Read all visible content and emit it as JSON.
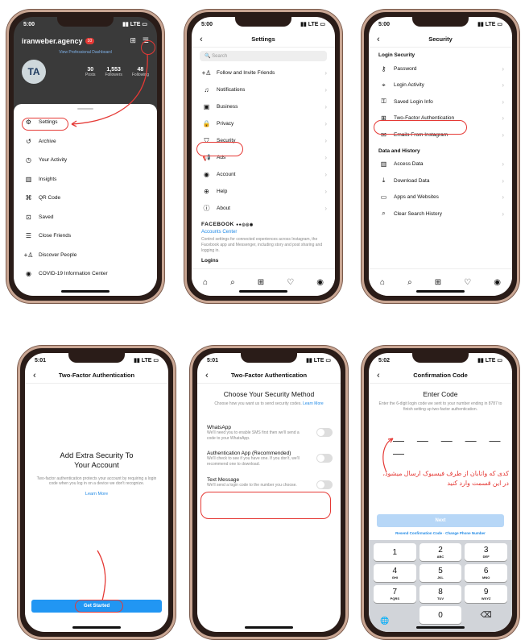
{
  "p1": {
    "time": "5:00",
    "username": "iranweber.agency",
    "badge": "10",
    "profile_link": "View Professional Dashboard",
    "stats": [
      {
        "n": "30",
        "l": "Posts"
      },
      {
        "n": "1,553",
        "l": "Followers"
      },
      {
        "n": "48",
        "l": "Following"
      }
    ],
    "menu": [
      {
        "label": "Settings",
        "icon": "⚙"
      },
      {
        "label": "Archive",
        "icon": "↺"
      },
      {
        "label": "Your Activity",
        "icon": "◷"
      },
      {
        "label": "Insights",
        "icon": "▥"
      },
      {
        "label": "QR Code",
        "icon": "⌘"
      },
      {
        "label": "Saved",
        "icon": "⊡"
      },
      {
        "label": "Close Friends",
        "icon": "☰"
      },
      {
        "label": "Discover People",
        "icon": "+♙"
      },
      {
        "label": "COVID-19 Information Center",
        "icon": "◉"
      }
    ]
  },
  "p2": {
    "time": "5:00",
    "title": "Settings",
    "search_placeholder": "Search",
    "items": [
      {
        "label": "Follow and Invite Friends",
        "icon": "+♙"
      },
      {
        "label": "Notifications",
        "icon": "♫"
      },
      {
        "label": "Business",
        "icon": "▣"
      },
      {
        "label": "Privacy",
        "icon": "🔒"
      },
      {
        "label": "Security",
        "icon": "⛉"
      },
      {
        "label": "Ads",
        "icon": "📢"
      },
      {
        "label": "Account",
        "icon": "◉"
      },
      {
        "label": "Help",
        "icon": "⊕"
      },
      {
        "label": "About",
        "icon": "ⓘ"
      }
    ],
    "facebook_label": "FACEBOOK",
    "accounts_center": "Accounts Center",
    "accounts_desc": "Control settings for connected experiences across Instagram, the Facebook app and Messenger, including story and post sharing and logging in.",
    "logins": "Logins"
  },
  "p3": {
    "time": "5:00",
    "title": "Security",
    "login_section": "Login Security",
    "login_items": [
      {
        "label": "Password",
        "icon": "⚷"
      },
      {
        "label": "Login Activity",
        "icon": "⌖"
      },
      {
        "label": "Saved Login Info",
        "icon": "⚿"
      },
      {
        "label": "Two-Factor Authentication",
        "icon": "⊞"
      },
      {
        "label": "Emails From Instagram",
        "icon": "✉"
      }
    ],
    "data_section": "Data and History",
    "data_items": [
      {
        "label": "Access Data",
        "icon": "▥"
      },
      {
        "label": "Download Data",
        "icon": "⤓"
      },
      {
        "label": "Apps and Websites",
        "icon": "▭"
      },
      {
        "label": "Clear Search History",
        "icon": "⌕"
      }
    ]
  },
  "p4": {
    "time": "5:01",
    "title": "Two-Factor Authentication",
    "heading": "Add Extra Security To Your Account",
    "desc": "Two-factor authentication protects your account by requiring a login code when you log in on a device we don't recognize.",
    "learn_more": "Learn More",
    "cta": "Get Started"
  },
  "p5": {
    "time": "5:01",
    "title": "Two-Factor Authentication",
    "heading": "Choose Your Security Method",
    "desc": "Choose how you want us to send security codes.",
    "learn_more": "Learn More",
    "options": [
      {
        "label": "WhatsApp",
        "desc": "We'll need you to enable SMS first then we'll send a code to your WhatsApp."
      },
      {
        "label": "Authentication App (Recommended)",
        "desc": "We'll check to see if you have one. If you don't, we'll recommend one to download."
      },
      {
        "label": "Text Message",
        "desc": "We'll send a login code to the number you choose."
      }
    ]
  },
  "p6": {
    "time": "5:02",
    "title": "Confirmation Code",
    "heading": "Enter Code",
    "desc": "Enter the 6-digit login code we sent to your number ending in 8787 to finish setting up two-factor authentication.",
    "annotation": "کدی که واتابان از طرف فیسبوک ارسال میشود، در این قسمت وارد کنید",
    "next": "Next",
    "resend": "Resend Confirmation Code · Change Phone Number",
    "keys": [
      {
        "n": "1",
        "l": ""
      },
      {
        "n": "2",
        "l": "ABC"
      },
      {
        "n": "3",
        "l": "DEF"
      },
      {
        "n": "4",
        "l": "GHI"
      },
      {
        "n": "5",
        "l": "JKL"
      },
      {
        "n": "6",
        "l": "MNO"
      },
      {
        "n": "7",
        "l": "PQRS"
      },
      {
        "n": "8",
        "l": "TUV"
      },
      {
        "n": "9",
        "l": "WXYZ"
      },
      {
        "n": "",
        "l": ""
      },
      {
        "n": "0",
        "l": ""
      },
      {
        "n": "⌫",
        "l": ""
      }
    ]
  },
  "colors": {
    "accent": "#e53935",
    "blue": "#2196f3"
  }
}
